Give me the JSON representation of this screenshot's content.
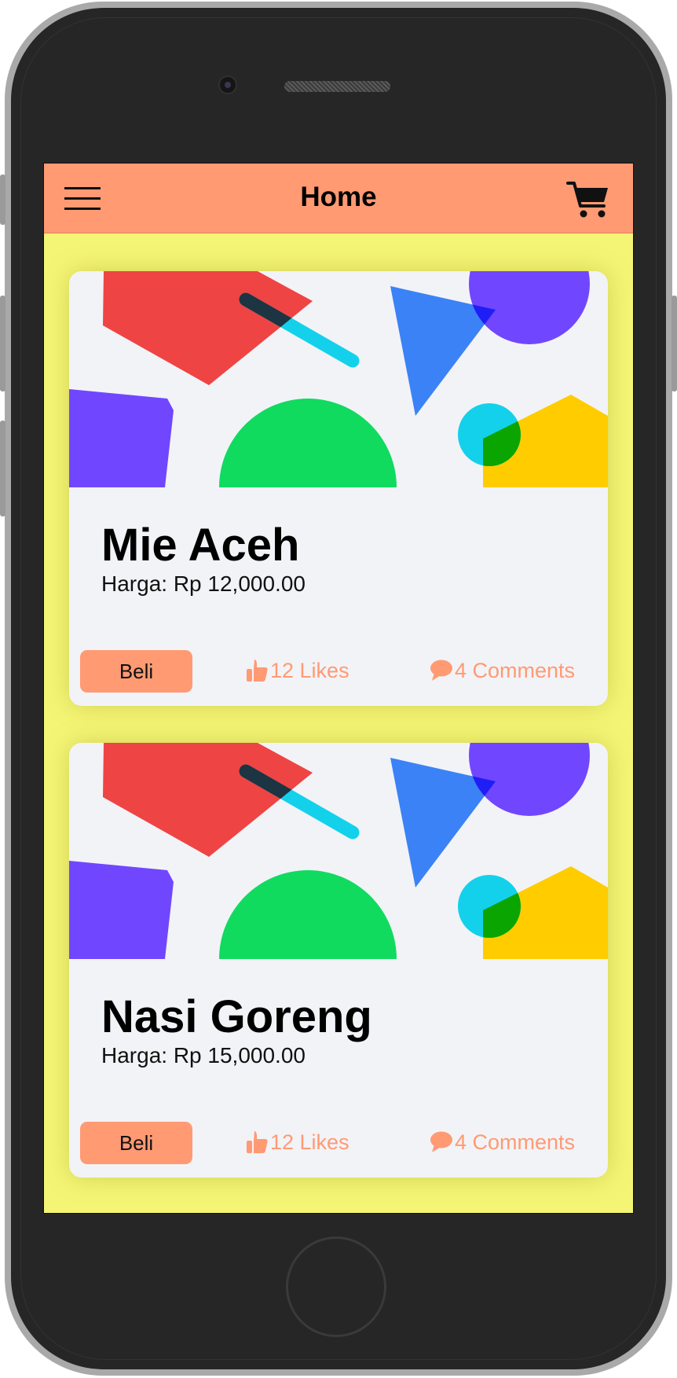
{
  "header": {
    "title": "Home"
  },
  "icons": {
    "menu": "menu-icon",
    "cart": "cart-icon",
    "like": "thumbs-up-icon",
    "comment": "comment-icon"
  },
  "colors": {
    "accent": "#ff9a73",
    "background": "#f5f575",
    "card": "#f2f3f7"
  },
  "products": [
    {
      "name": "Mie Aceh",
      "price": "Harga: Rp 12,000.00",
      "buy_label": "Beli",
      "likes": "12 Likes",
      "comments": "4 Comments"
    },
    {
      "name": "Nasi Goreng",
      "price": "Harga: Rp 15,000.00",
      "buy_label": "Beli",
      "likes": "12 Likes",
      "comments": "4 Comments"
    }
  ]
}
